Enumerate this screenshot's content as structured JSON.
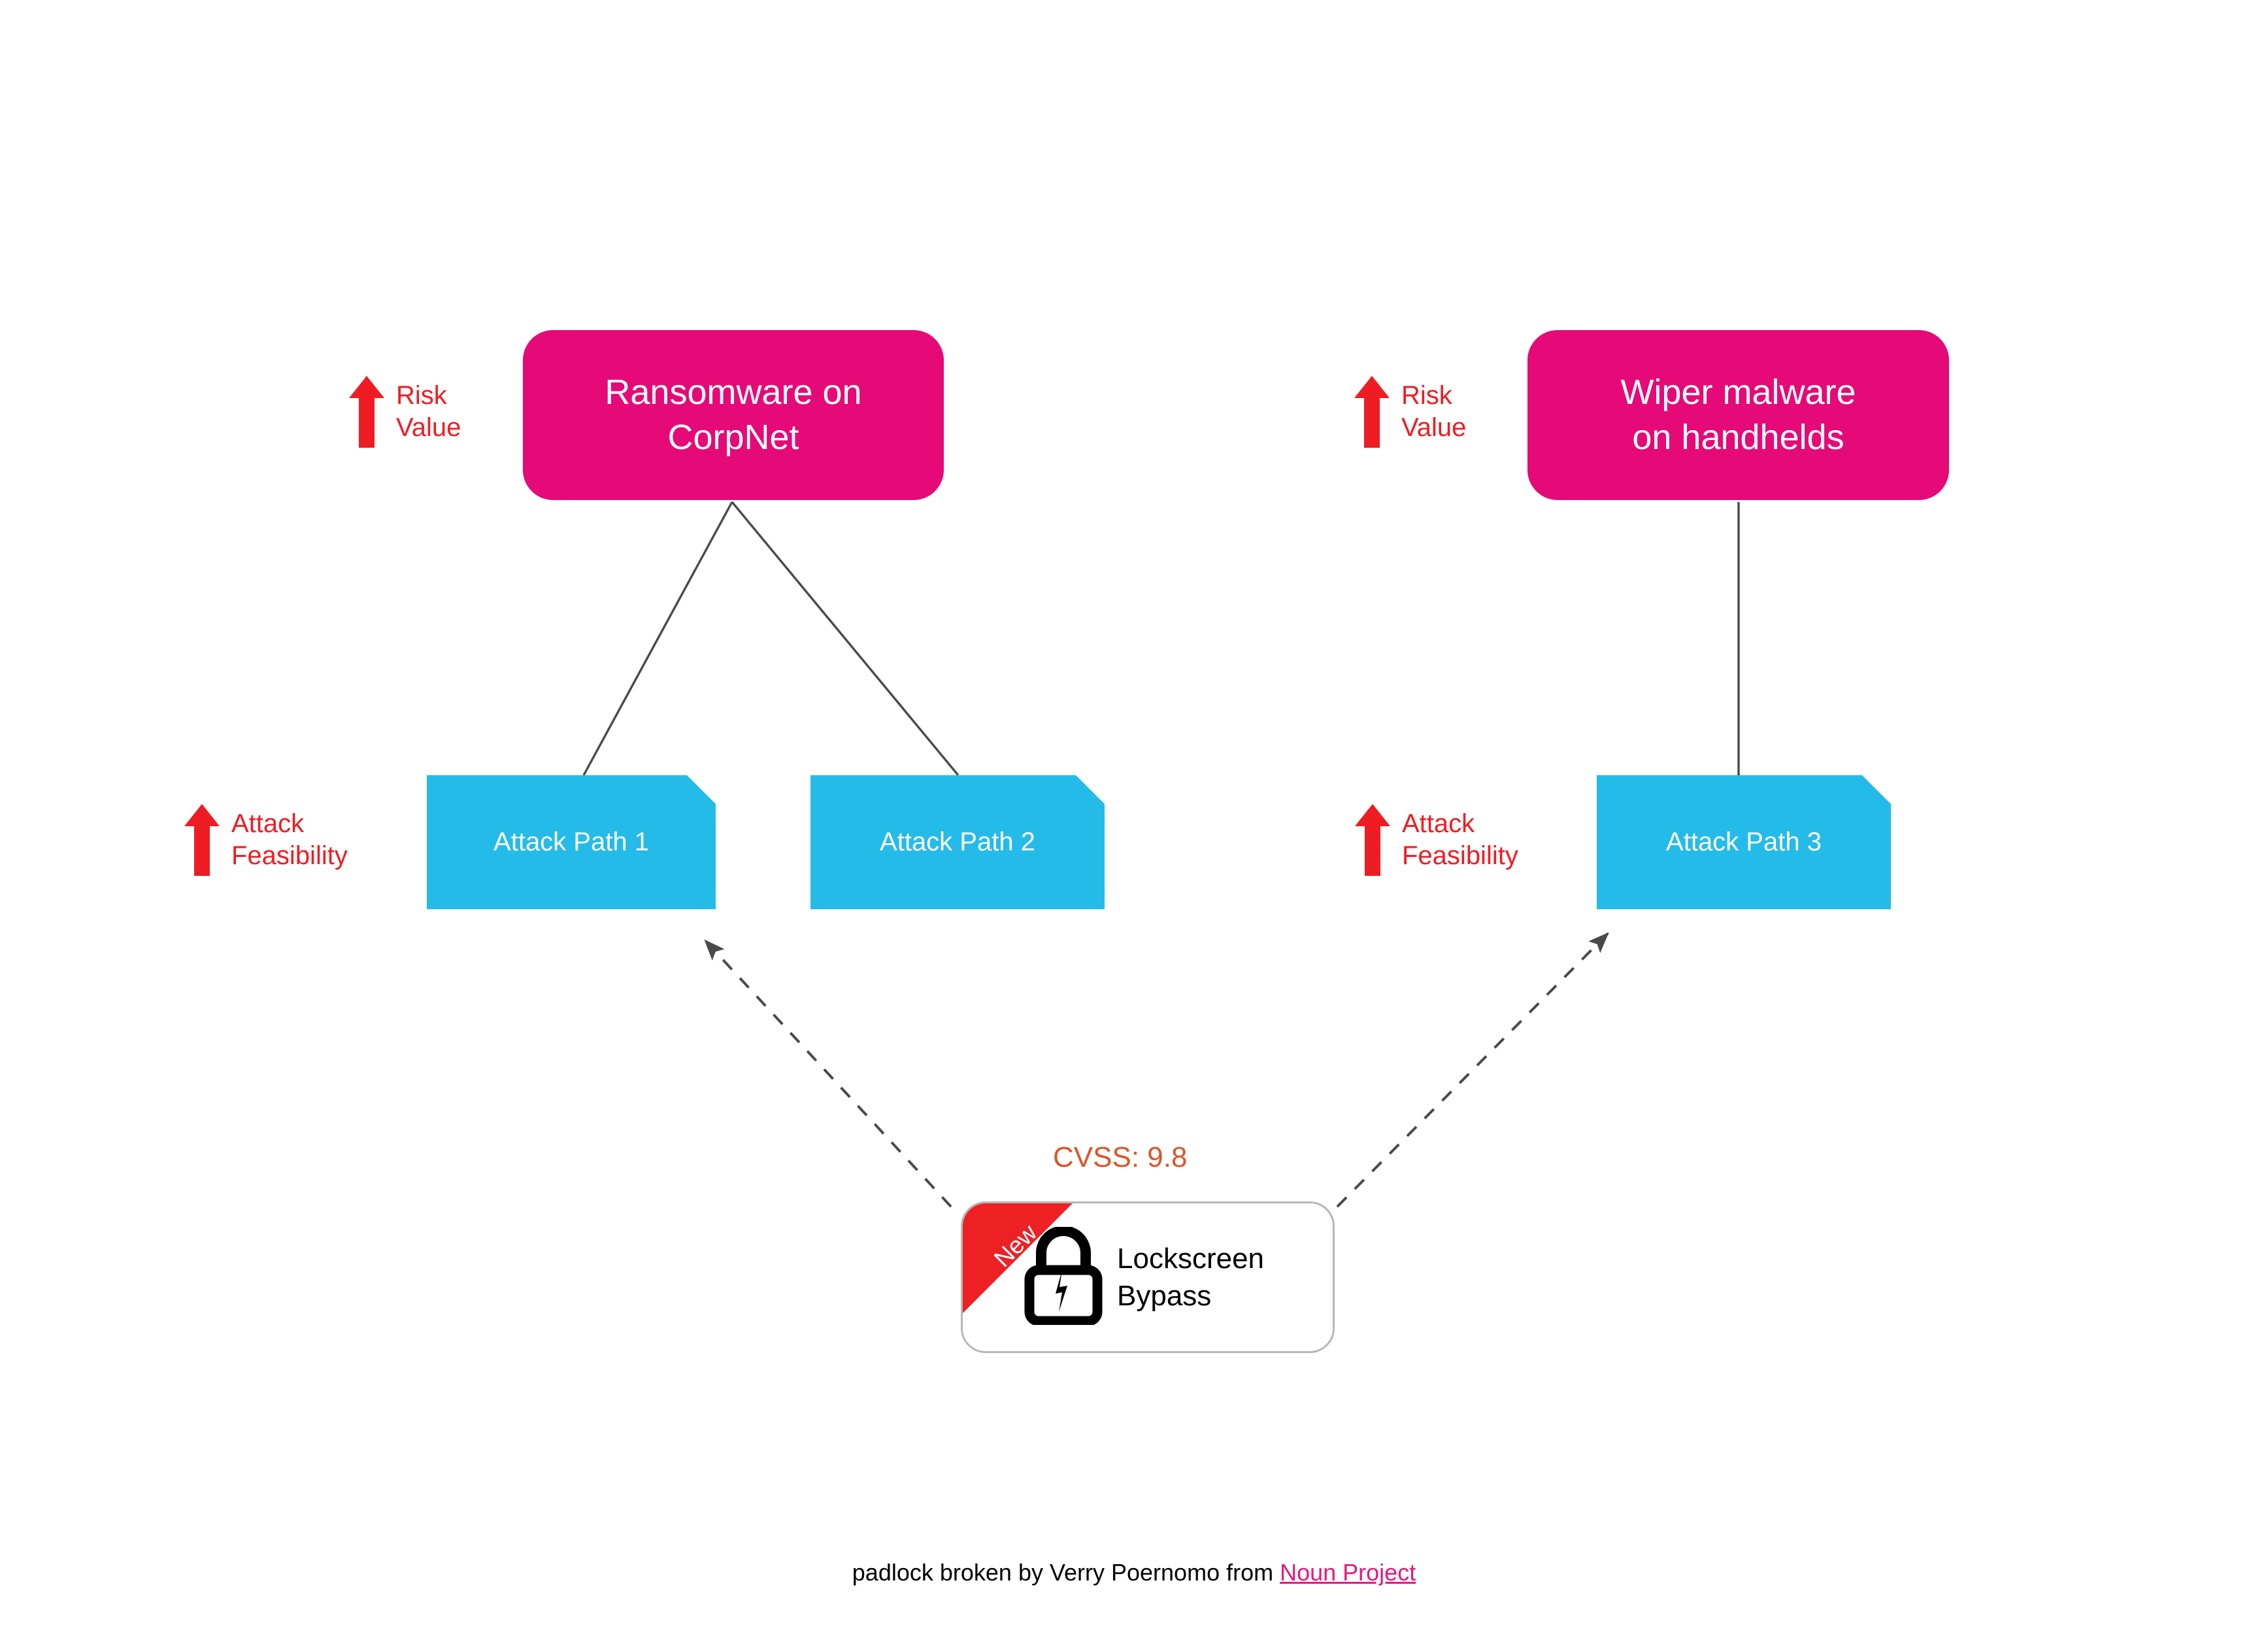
{
  "colors": {
    "scenario_pink": "#e50a78",
    "attack_cyan": "#25bbe9",
    "annotation_red": "#ee1d23",
    "ribbon_red": "#ed2024",
    "cvss_orange": "#dd5529",
    "edge_gray": "#4a4a4a",
    "link_pink": "#e5197d",
    "background": "#ffffff"
  },
  "annotations": [
    {
      "label": "Risk\nValue",
      "icon": "up-arrow-icon"
    },
    {
      "label": "Risk\nValue",
      "icon": "up-arrow-icon"
    },
    {
      "label": "Attack\nFeasibility",
      "icon": "up-arrow-icon"
    },
    {
      "label": "Attack\nFeasibility",
      "icon": "up-arrow-icon"
    }
  ],
  "scenarios": [
    {
      "label": "Ransomware on\nCorpNet"
    },
    {
      "label": "Wiper malware\non handhelds"
    }
  ],
  "attack_paths": [
    {
      "label": "Attack Path 1"
    },
    {
      "label": "Attack Path 2"
    },
    {
      "label": "Attack Path 3"
    }
  ],
  "vulnerability": {
    "ribbon": "New",
    "label": "Lockscreen\nBypass",
    "icon": "broken-padlock-icon",
    "cvss": "CVSS: 9.8"
  },
  "attribution": {
    "prefix": "padlock broken by Verry Poernomo from ",
    "link": "Noun Project"
  }
}
